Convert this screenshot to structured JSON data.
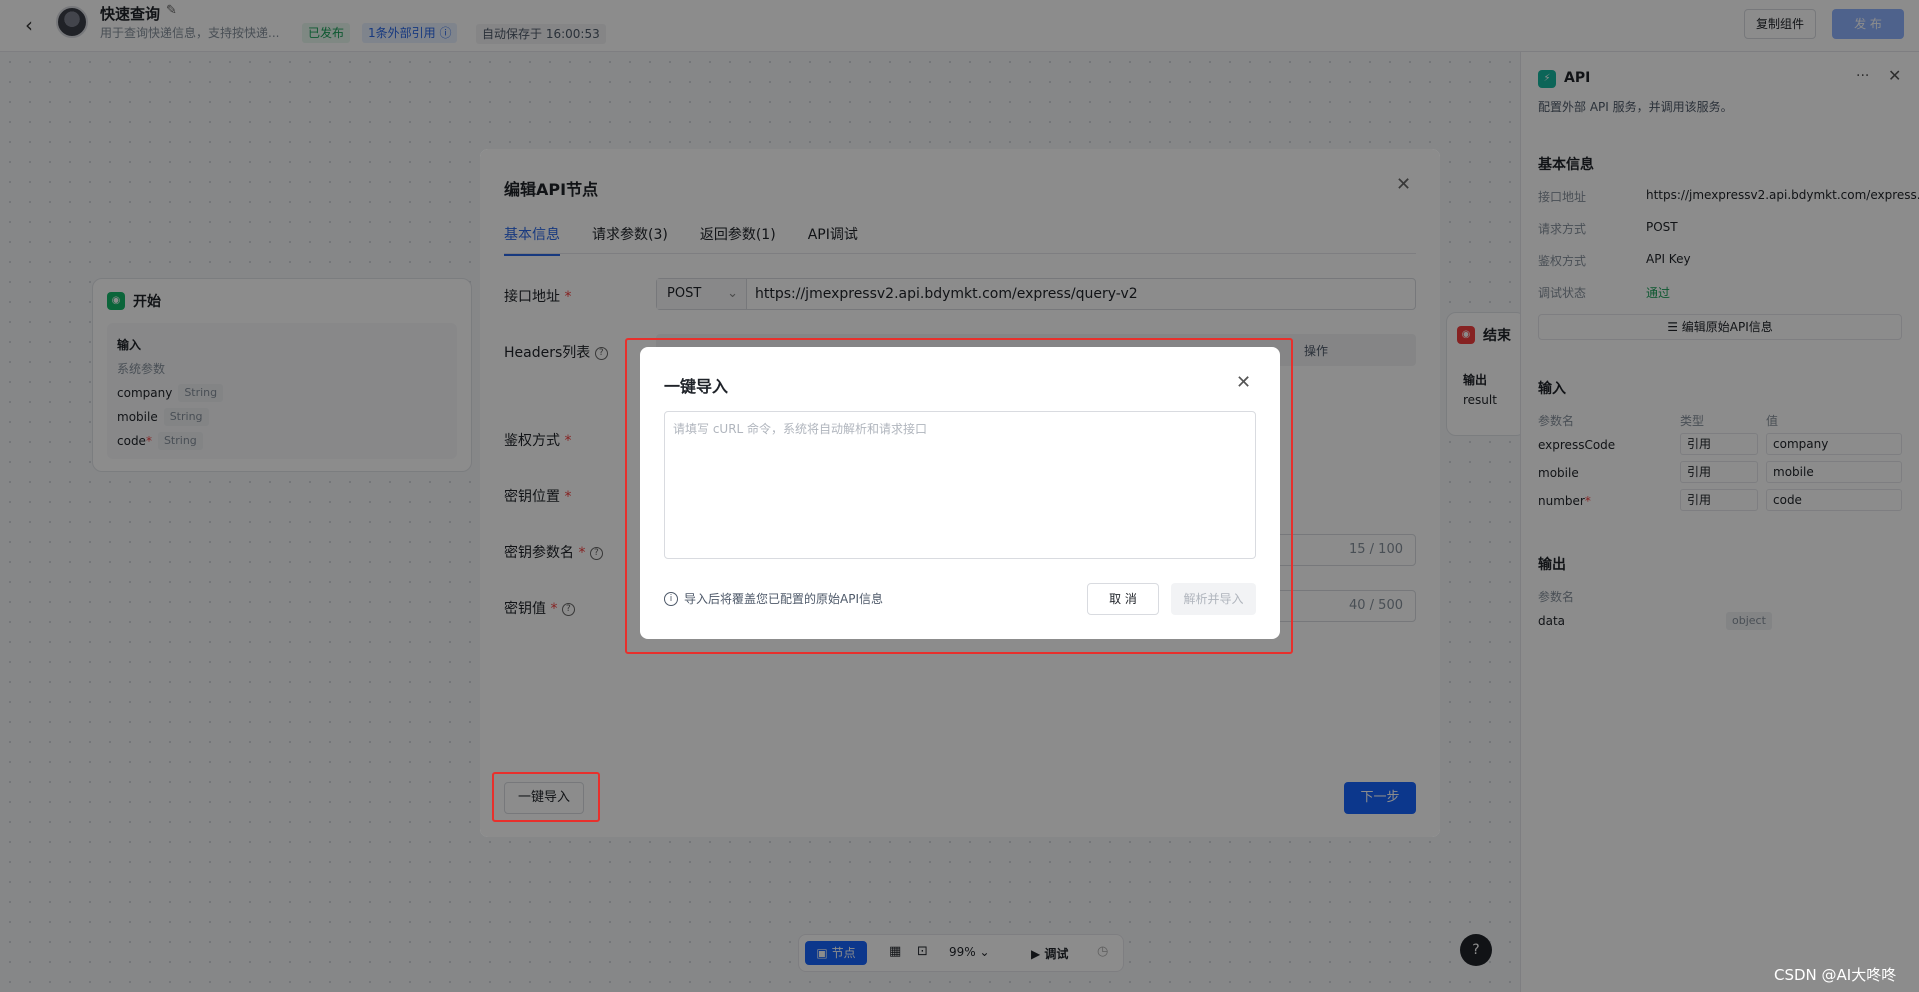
{
  "header": {
    "title": "快速查询",
    "description": "用于查询快递信息，支持按快递...",
    "status_badge": "已发布",
    "refs_badge": "1条外部引用",
    "autosave": "自动保存于 16:00:53",
    "copy_button": "复制组件",
    "publish_button": "发 布"
  },
  "start_node": {
    "title": "开始",
    "input_label": "输入",
    "sys_params": "系统参数",
    "params": [
      {
        "name": "company",
        "type": "String",
        "required": false
      },
      {
        "name": "mobile",
        "type": "String",
        "required": false
      },
      {
        "name": "code",
        "type": "String",
        "required": true
      }
    ]
  },
  "end_node": {
    "title": "结束",
    "output_label": "输出",
    "param": "result"
  },
  "right_panel": {
    "title": "API",
    "more": "···",
    "description": "配置外部 API 服务，并调用该服务。",
    "basic_info": "基本信息",
    "fields": [
      {
        "label": "接口地址",
        "value": "https://jmexpressv2.api.bdymkt.com/express..."
      },
      {
        "label": "请求方式",
        "value": "POST"
      },
      {
        "label": "鉴权方式",
        "value": "API Key"
      },
      {
        "label": "调试状态",
        "value": "通过"
      }
    ],
    "edit_button": "编辑原始API信息",
    "input_section": "输入",
    "input_headers": [
      "参数名",
      "类型",
      "值"
    ],
    "inputs": [
      {
        "name": "expressCode",
        "type": "引用",
        "value": "company",
        "required": false
      },
      {
        "name": "mobile",
        "type": "引用",
        "value": "mobile",
        "required": false
      },
      {
        "name": "number",
        "type": "引用",
        "value": "code",
        "required": true
      }
    ],
    "output_section": "输出",
    "output_header": "参数名",
    "outputs": [
      {
        "name": "data",
        "type": "object"
      }
    ]
  },
  "toolbar": {
    "node_button": "节点",
    "zoom": "99%",
    "debug_button": "调试"
  },
  "help": "?",
  "watermark": "CSDN @AI大咚咚",
  "modal": {
    "title": "编辑API节点",
    "tabs": [
      "基本信息",
      "请求参数(3)",
      "返回参数(1)",
      "API调试"
    ],
    "labels": {
      "url": "接口地址",
      "headers": "Headers列表",
      "auth": "鉴权方式",
      "key_location": "密钥位置",
      "key_param_name": "密钥参数名",
      "key_value": "密钥值"
    },
    "method": "POST",
    "url": "https://jmexpressv2.api.bdymkt.com/express/query-v2",
    "headers_col_action": "操作",
    "key_param_count": "15 / 100",
    "key_value_count": "40 / 500",
    "import_button": "一键导入",
    "next_button": "下一步"
  },
  "dialog": {
    "title": "一键导入",
    "placeholder": "请填写 cURL 命令，系统将自动解析和请求接口",
    "note": "导入后将覆盖您已配置的原始API信息",
    "cancel": "取 消",
    "parse": "解析并导入"
  }
}
